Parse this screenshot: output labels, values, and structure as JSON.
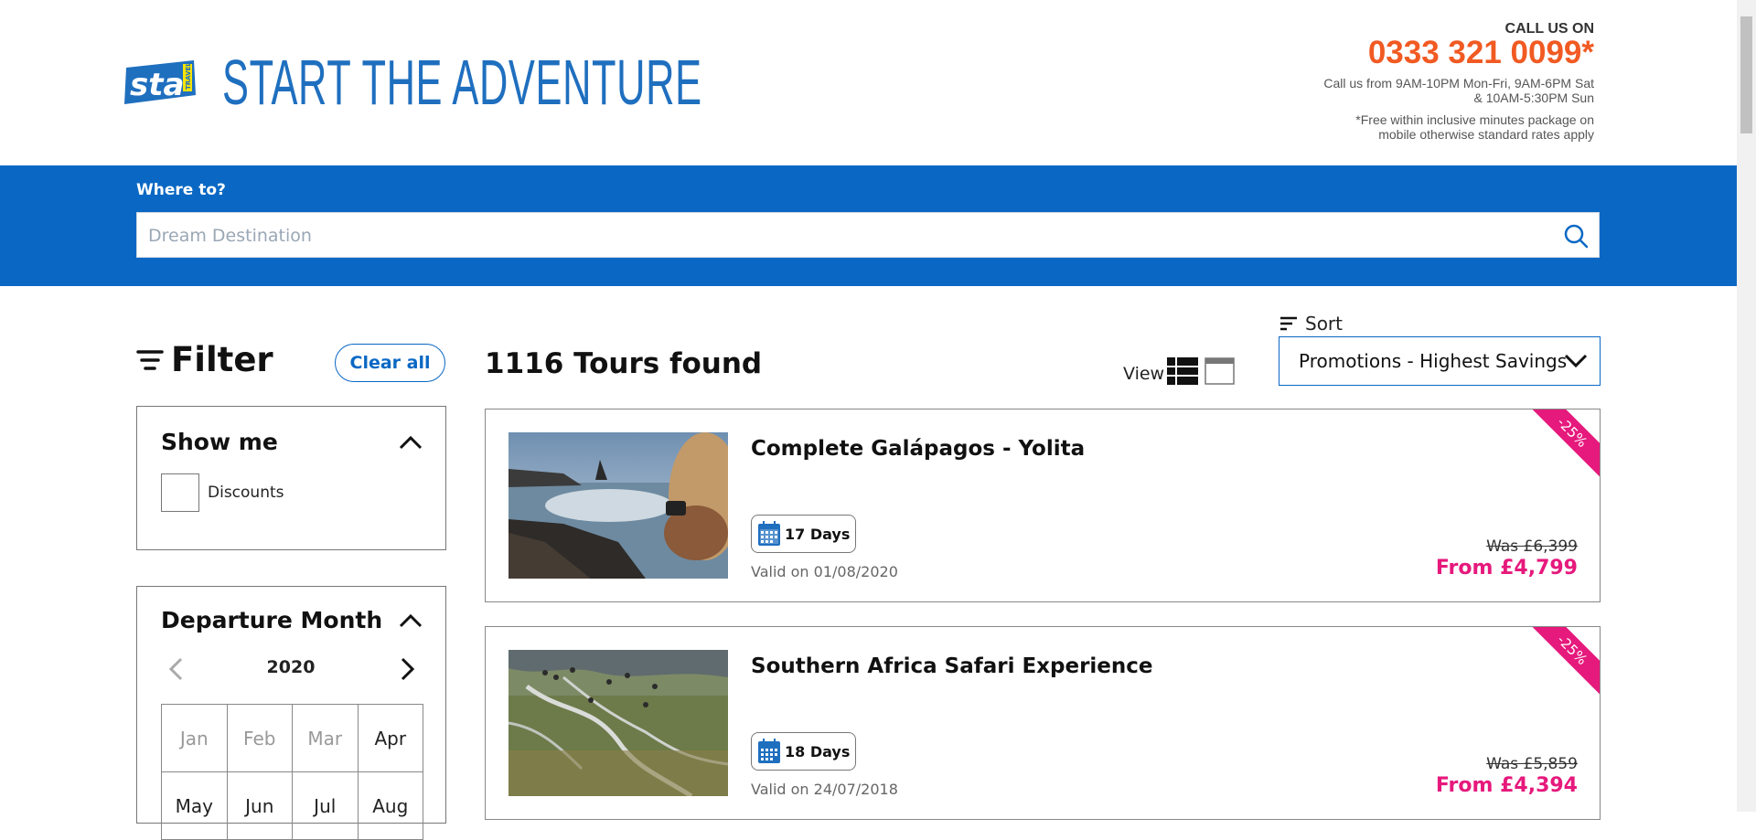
{
  "header": {
    "logo_text": "sta",
    "logo_subtext": "TRAVEL",
    "tagline": "START THE ADVENTURE",
    "call_label": "CALL US ON",
    "phone": "0333 321 0099*",
    "hours": "Call us from 9AM-10PM Mon-Fri, 9AM-6PM Sat & 10AM-5:30PM Sun",
    "free_note": "*Free within inclusive minutes package on mobile otherwise standard rates apply"
  },
  "search": {
    "label": "Where to?",
    "placeholder": "Dream Destination",
    "icon": "search-icon"
  },
  "filter": {
    "title": "Filter",
    "clear_all": "Clear all",
    "show_me": {
      "title": "Show me",
      "option": "Discounts"
    },
    "departure": {
      "title": "Departure Month",
      "year": "2020",
      "months": [
        {
          "label": "Jan",
          "disabled": true
        },
        {
          "label": "Feb",
          "disabled": true
        },
        {
          "label": "Mar",
          "disabled": true
        },
        {
          "label": "Apr",
          "disabled": false
        },
        {
          "label": "May",
          "disabled": false
        },
        {
          "label": "Jun",
          "disabled": false
        },
        {
          "label": "Jul",
          "disabled": false
        },
        {
          "label": "Aug",
          "disabled": false
        }
      ]
    }
  },
  "results": {
    "count_text": "1116 Tours found",
    "view_label": "View",
    "sort_label": "Sort",
    "sort_value": "Promotions - Highest Savings"
  },
  "tours": [
    {
      "title": "Complete Galápagos - Yolita",
      "days": "17 Days",
      "valid": "Valid on 01/08/2020",
      "was": "Was £6,399",
      "from": "From £4,799",
      "discount": "-25%"
    },
    {
      "title": "Southern Africa Safari Experience",
      "days": "18 Days",
      "valid": "Valid on 24/07/2018",
      "was": "Was £5,859",
      "from": "From £4,394",
      "discount": "-25%"
    }
  ],
  "colors": {
    "brand_blue": "#0a68c4",
    "phone_orange": "#f15a22",
    "price_pink": "#e6197c"
  }
}
